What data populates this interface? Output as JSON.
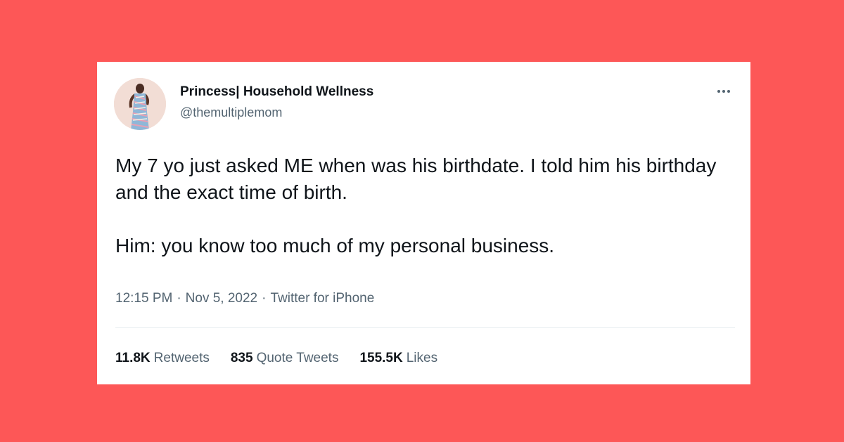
{
  "tweet": {
    "display_name": "Princess| Household Wellness",
    "handle": "@themultiplemom",
    "text_para1": "My 7 yo just asked ME when was his birthdate. I told him his birthday and the exact time of birth.",
    "text_para2": "Him: you know too much of my personal business.",
    "time": "12:15 PM",
    "date": "Nov 5, 2022",
    "source": "Twitter for iPhone",
    "separator": "·",
    "more_icon": "ellipsis-icon"
  },
  "stats": {
    "retweets_count": "11.8K",
    "retweets_label": "Retweets",
    "quotes_count": "835",
    "quotes_label": "Quote Tweets",
    "likes_count": "155.5K",
    "likes_label": "Likes"
  },
  "colors": {
    "background": "#fd5757",
    "card": "#ffffff",
    "primary_text": "#0f1419",
    "secondary_text": "#536471"
  }
}
